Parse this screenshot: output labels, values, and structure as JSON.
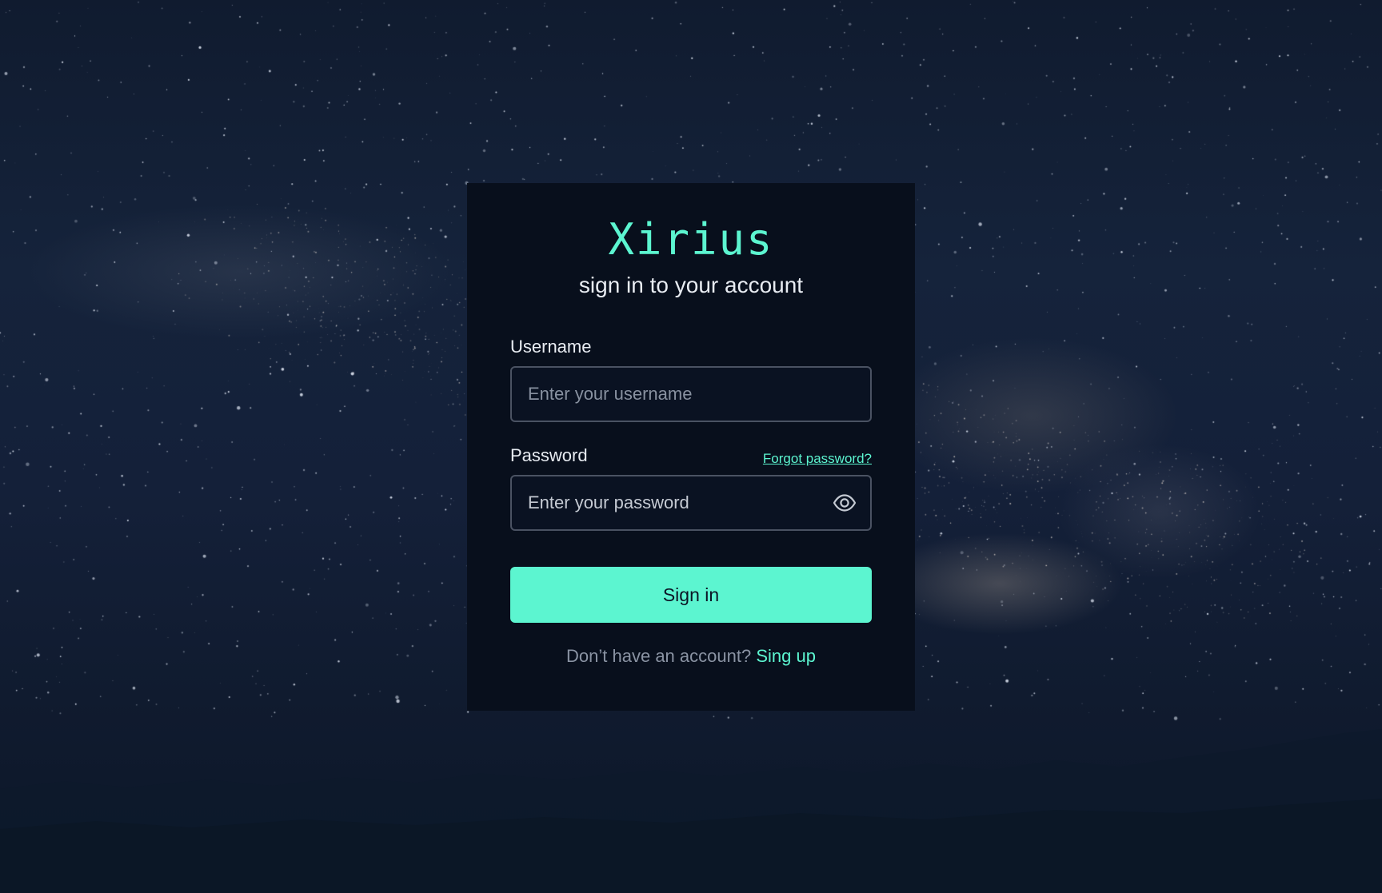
{
  "brand": {
    "name": "Xirius",
    "accent_color": "#5cf5d0"
  },
  "form": {
    "subtitle": "sign in to your account",
    "username": {
      "label": "Username",
      "value": "",
      "placeholder": "Enter your username"
    },
    "password": {
      "label": "Password",
      "value": "",
      "placeholder": "Enter your password",
      "toggle_icon": "eye-icon"
    },
    "forgot_password_link": "Forgot password?",
    "submit_label": "Sign in",
    "signup_prompt": "Don’t have an account?",
    "signup_link": "Sing up"
  },
  "background": {
    "scene": "starry-night-sky-icon"
  }
}
